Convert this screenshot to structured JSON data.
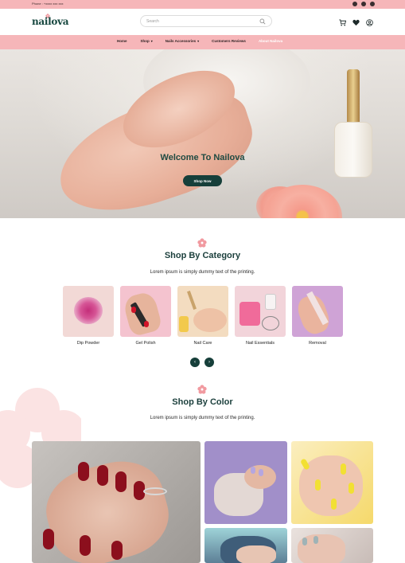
{
  "topbar": {
    "phone": "Phone : +xxxx xxx xxx",
    "social": [
      "facebook-icon",
      "instagram-icon",
      "twitter-icon"
    ]
  },
  "header": {
    "logo": "nailova",
    "search_placeholder": "Search",
    "icons": [
      "cart-icon",
      "heart-icon",
      "user-icon"
    ]
  },
  "nav": {
    "items": [
      {
        "label": "Home",
        "caret": false,
        "active": false
      },
      {
        "label": "Shop",
        "caret": true,
        "active": false
      },
      {
        "label": "Nails Accessories",
        "caret": true,
        "active": false
      },
      {
        "label": "Customers Reviews",
        "caret": false,
        "active": false
      },
      {
        "label": "About Nailova",
        "caret": false,
        "active": true
      }
    ]
  },
  "hero": {
    "title": "Welcome To Nailova",
    "button": "Shop Now"
  },
  "category": {
    "title": "Shop By Category",
    "subtitle": "Lorem ipsum is simply dummy text of the printing.",
    "items": [
      {
        "label": "Dip Powder"
      },
      {
        "label": "Gel Polish"
      },
      {
        "label": "Nail Care"
      },
      {
        "label": "Nail Essentials"
      },
      {
        "label": "Removal"
      }
    ],
    "prev": "‹",
    "next": "›"
  },
  "color": {
    "title": "Shop By Color",
    "subtitle": "Lorem ipsum is simply dummy text of the printing."
  },
  "colors": {
    "brand": "#163f3a",
    "pink": "#f6b6b9"
  }
}
